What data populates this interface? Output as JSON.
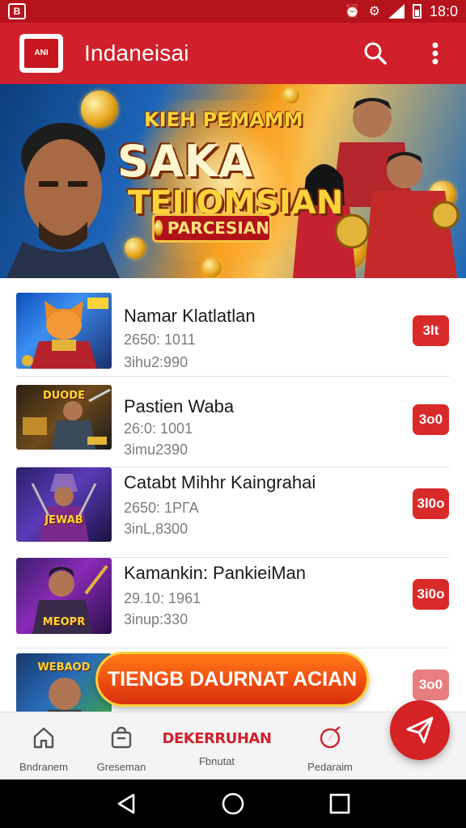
{
  "status_bar": {
    "time": "18:0",
    "icons": [
      "notification-icon",
      "alarm-icon",
      "settings-icon",
      "signal-icon",
      "battery-icon"
    ]
  },
  "app_bar": {
    "logo_text": "ANI",
    "title": "Indaneisai",
    "icons": [
      "search-icon",
      "more-vert-icon"
    ]
  },
  "banner": {
    "title_top": "KIEH PEMAMM",
    "title_main": "SAKA",
    "title_sub": "TEIIOMSIAN",
    "button_label": "PARCESIAN"
  },
  "list": {
    "items": [
      {
        "title": "Namar Klatlatlan",
        "line1": "2650: 1011",
        "line2": "3ihu2:990",
        "badge": "3lt",
        "thumb_label": ""
      },
      {
        "title": "Pastien Waba",
        "line1": "26:0: 1001",
        "line2": "3imu2390",
        "badge": "3o0",
        "thumb_label": "DUODE"
      },
      {
        "title": "Catabt Mihhr Kaingrahai",
        "line1": "2650: 1РГА",
        "line2": "3inL,8300",
        "badge": "3l0o",
        "thumb_label": "JEWAB"
      },
      {
        "title": "Kamankin: PankieiMan",
        "line1": "29.10: 1961",
        "line2": "3inup:330",
        "badge": "3i0o",
        "thumb_label": "MEOPR"
      },
      {
        "title": "",
        "line1": "",
        "line2": "",
        "badge": "3o0",
        "thumb_label": "WEBAOD"
      }
    ]
  },
  "cta": {
    "label": "TIENGB DAURNAT ACIAN"
  },
  "bottom_nav": {
    "items": [
      {
        "label": "Bndranem",
        "icon": "home-icon"
      },
      {
        "label": "Greseman",
        "icon": "bag-icon"
      },
      {
        "label": "Fbnutat",
        "icon": "center-logo",
        "logo_text": "DEKERRUHAN"
      },
      {
        "label": "Pedaraim",
        "icon": "compass-icon"
      }
    ],
    "fab_icon": "send-icon"
  },
  "colors": {
    "primary": "#d0202b",
    "status": "#b5121b",
    "badge": "#d92a2a",
    "cta": "#ef4d10",
    "cta_border": "#ffce3a"
  }
}
